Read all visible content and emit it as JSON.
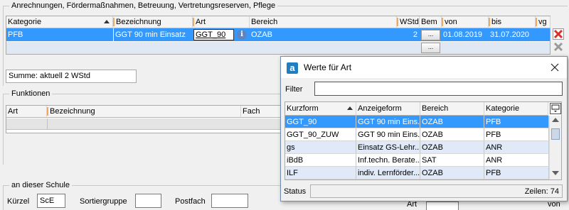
{
  "anrechnungen": {
    "title": "Anrechnungen, Fördermaßnahmen, Betreuung, Vertretungsreserven, Pflege",
    "columns": [
      "Kategorie",
      "Bezeichnung",
      "Art",
      "Bereich",
      "WStd",
      "Bem",
      "von",
      "bis",
      "vg"
    ],
    "row": {
      "kategorie": "PFB",
      "bezeichnung": "GGT 90 min Einsatz",
      "art": "GGT_90",
      "bereich": "OZAB",
      "wstd": "2",
      "bem": "...",
      "von": "01.08.2019",
      "bis": "31.07.2020"
    },
    "new_row_bem": "...",
    "summe": "Summe: aktuell 2 WStd"
  },
  "funktionen": {
    "title": "Funktionen",
    "columns": [
      "Art",
      "Bezeichnung",
      "Fach"
    ]
  },
  "schule": {
    "title": "an dieser Schule",
    "kuerzel_label": "Kürzel",
    "kuerzel_value": "ScE",
    "sortiergruppe_label": "Sortiergruppe",
    "postfach_label": "Postfach",
    "art_label": "Art",
    "von_label": "von"
  },
  "dialog": {
    "title": "Werte für Art",
    "app_letter": "a",
    "filter_label": "Filter",
    "filter_value": "",
    "columns": [
      "Kurzform",
      "Anzeigeform",
      "Bereich",
      "Kategorie"
    ],
    "rows": [
      {
        "kurzform": "GGT_90",
        "anzeigeform": "GGT 90 min Eins...",
        "bereich": "OZAB",
        "kategorie": "PFB",
        "style": "selected"
      },
      {
        "kurzform": "GGT_90_ZUW",
        "anzeigeform": "GGT 90 min Eins...",
        "bereich": "OZAB",
        "kategorie": "PFB",
        "style": "white"
      },
      {
        "kurzform": "gs",
        "anzeigeform": "Einsatz GS-Lehr...",
        "bereich": "OZAB",
        "kategorie": "ANR",
        "style": "blue"
      },
      {
        "kurzform": "iBdB",
        "anzeigeform": "Inf.techn. Berate...",
        "bereich": "SAT",
        "kategorie": "ANR",
        "style": "white"
      },
      {
        "kurzform": "ILF",
        "anzeigeform": "indiv. Lernförder...",
        "bereich": "OZAB",
        "kategorie": "PFB",
        "style": "blue"
      }
    ],
    "status_label": "Status",
    "zeilen_text": "Zeilen: 74"
  },
  "colors": {
    "selection": "#3399ff",
    "light_row": "#dfe9f7",
    "accent_orange": "#f0a860",
    "delete_red": "#d9302c"
  }
}
